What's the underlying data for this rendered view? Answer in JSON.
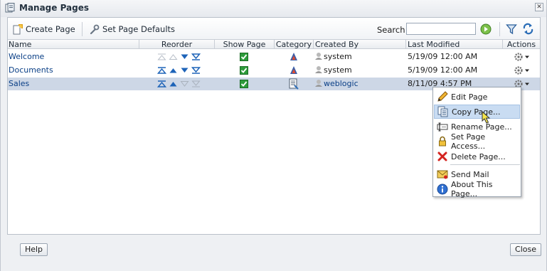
{
  "dialog": {
    "title": "Manage Pages",
    "close_glyph": "✕"
  },
  "toolbar": {
    "create_page": "Create Page",
    "set_defaults": "Set Page Defaults",
    "search_label": "Search",
    "search_value": "",
    "search_placeholder": ""
  },
  "columns": {
    "name": "Name",
    "reorder": "Reorder",
    "show_page": "Show Page",
    "category": "Category",
    "created_by": "Created By",
    "last_modified": "Last Modified",
    "actions": "Actions"
  },
  "rows": [
    {
      "name": "Welcome",
      "created_by": "system",
      "last_modified": "5/19/09 12:00 AM",
      "show_page": true,
      "selected": false
    },
    {
      "name": "Documents",
      "created_by": "system",
      "last_modified": "5/19/09 12:00 AM",
      "show_page": true,
      "selected": false
    },
    {
      "name": "Sales",
      "created_by": "weblogic",
      "last_modified": "8/11/09 4:57 PM",
      "show_page": true,
      "selected": true
    }
  ],
  "menu": {
    "items": [
      {
        "label": "Edit Page",
        "icon": "pencil-icon"
      },
      {
        "label": "Copy Page...",
        "icon": "copy-icon",
        "highlighted": true
      },
      {
        "label": "Rename Page...",
        "icon": "rename-icon"
      },
      {
        "label": "Set Page Access...",
        "icon": "lock-icon"
      },
      {
        "label": "Delete Page...",
        "icon": "delete-icon"
      },
      {
        "label": "Send Mail",
        "icon": "mail-icon"
      },
      {
        "label": "About This Page...",
        "icon": "info-icon"
      }
    ]
  },
  "footer": {
    "help": "Help",
    "close": "Close"
  },
  "colors": {
    "link": "#0a3f86",
    "selected_row": "#cdd7e6",
    "menu_highlight": "#c9dcf2"
  }
}
